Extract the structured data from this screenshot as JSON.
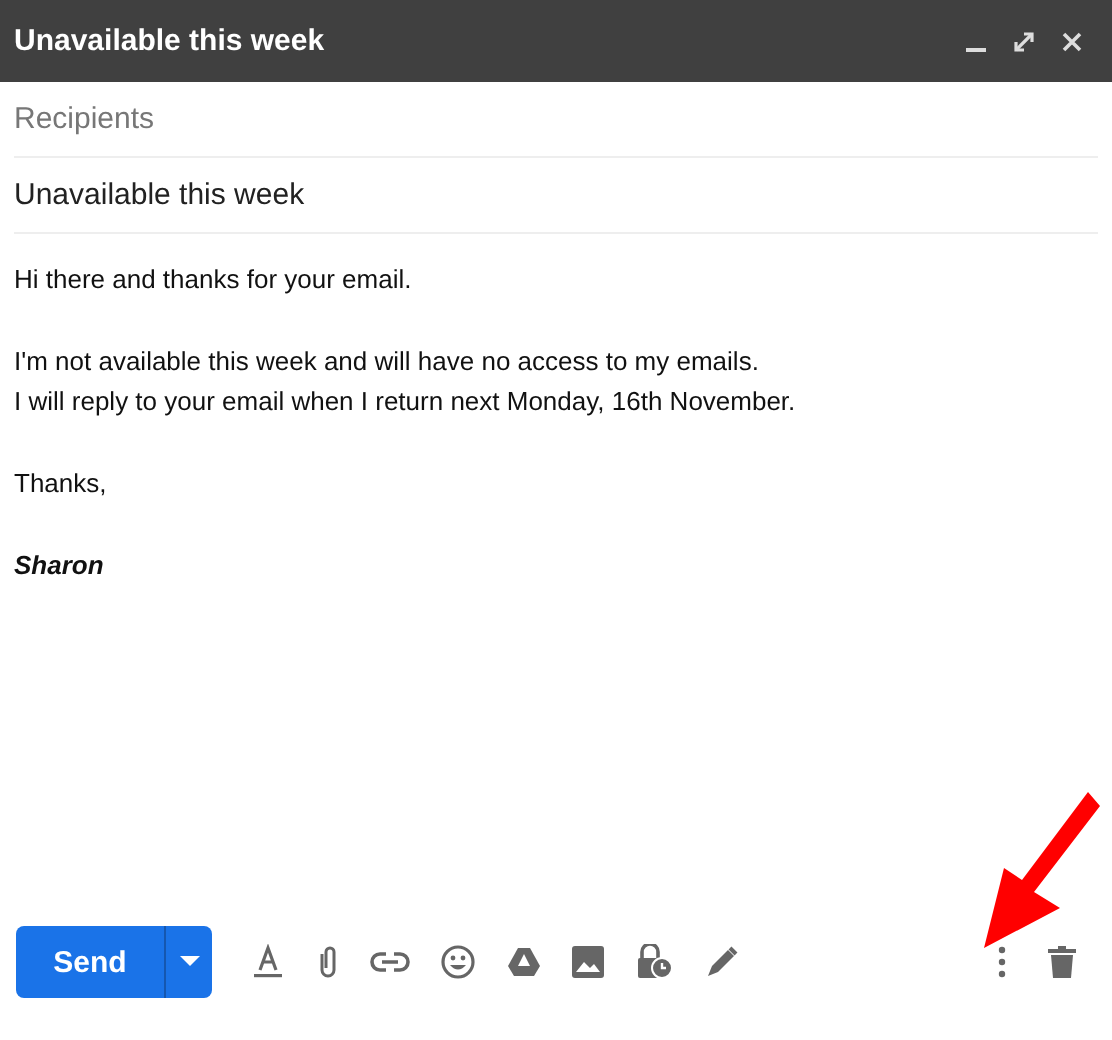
{
  "window": {
    "title": "Unavailable this week"
  },
  "recipients": {
    "placeholder": "Recipients"
  },
  "subject": {
    "value": "Unavailable this week"
  },
  "body": {
    "paragraphs": [
      [
        "Hi there and thanks for your email."
      ],
      [
        "I'm not available this week and will have no access to my emails.",
        "I will reply to your email when I return next Monday, 16th November."
      ],
      [
        "Thanks,"
      ]
    ],
    "signature": "Sharon"
  },
  "send_button": {
    "label": "Send"
  }
}
